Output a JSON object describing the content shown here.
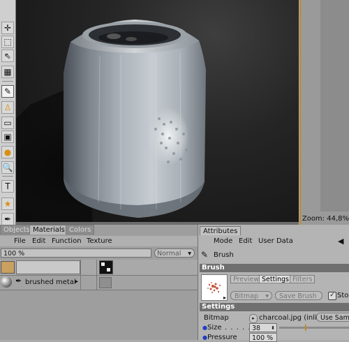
{
  "viewport": {
    "zoom_label": "Zoom: 44,8%"
  },
  "toolbar": {
    "tools": [
      {
        "name": "move-tool-icon",
        "glyph": "✛"
      },
      {
        "name": "rect-select-icon",
        "glyph": "⬚"
      },
      {
        "name": "live-select-icon",
        "glyph": "⇖"
      },
      {
        "name": "camera-icon",
        "glyph": "▦"
      },
      {
        "name": "brush-tool-icon",
        "glyph": "✎"
      },
      {
        "name": "stamp-tool-icon",
        "glyph": "♙"
      },
      {
        "name": "eraser-tool-icon",
        "glyph": "▭"
      },
      {
        "name": "fill-tool-icon",
        "glyph": "▣"
      },
      {
        "name": "drop-tool-icon",
        "glyph": "●"
      },
      {
        "name": "magnify-tool-icon",
        "glyph": "🔍"
      },
      {
        "name": "text-tool-icon",
        "glyph": "T"
      },
      {
        "name": "star-tool-icon",
        "glyph": "★"
      },
      {
        "name": "dropper-tool-icon",
        "glyph": "✒"
      }
    ]
  },
  "materials": {
    "tabs": [
      "Objects",
      "Materials",
      "Colors"
    ],
    "menu": [
      "File",
      "Edit",
      "Function",
      "Texture"
    ],
    "zoom_value": "100 %",
    "blend_mode": "Normal",
    "layer_name": "brushed metal",
    "arrow": "▸"
  },
  "attributes": {
    "tab": "Attributes",
    "menu": [
      "Mode",
      "Edit",
      "User Data"
    ],
    "back_arrow": "◀",
    "tool_name": "Brush",
    "section_brush": "Brush",
    "subtabs": [
      "Preview",
      "Settings",
      "Filters"
    ],
    "bitmap_select": "Bitmap",
    "save_brush": "Save Brush",
    "store_label": "Sto",
    "section_settings": "Settings",
    "bitmap_label": "Bitmap",
    "bitmap_file": "charcoal.jpg (inli",
    "use_sample": "Use Sam",
    "size_label": "Size",
    "size_dots": ". . . . . .",
    "size_value": "38",
    "pressure_label": "Pressure",
    "pressure_value": "100 %"
  },
  "colors": {
    "accent": "#c28a2c",
    "viewport_bg": "#1e1e1e"
  }
}
